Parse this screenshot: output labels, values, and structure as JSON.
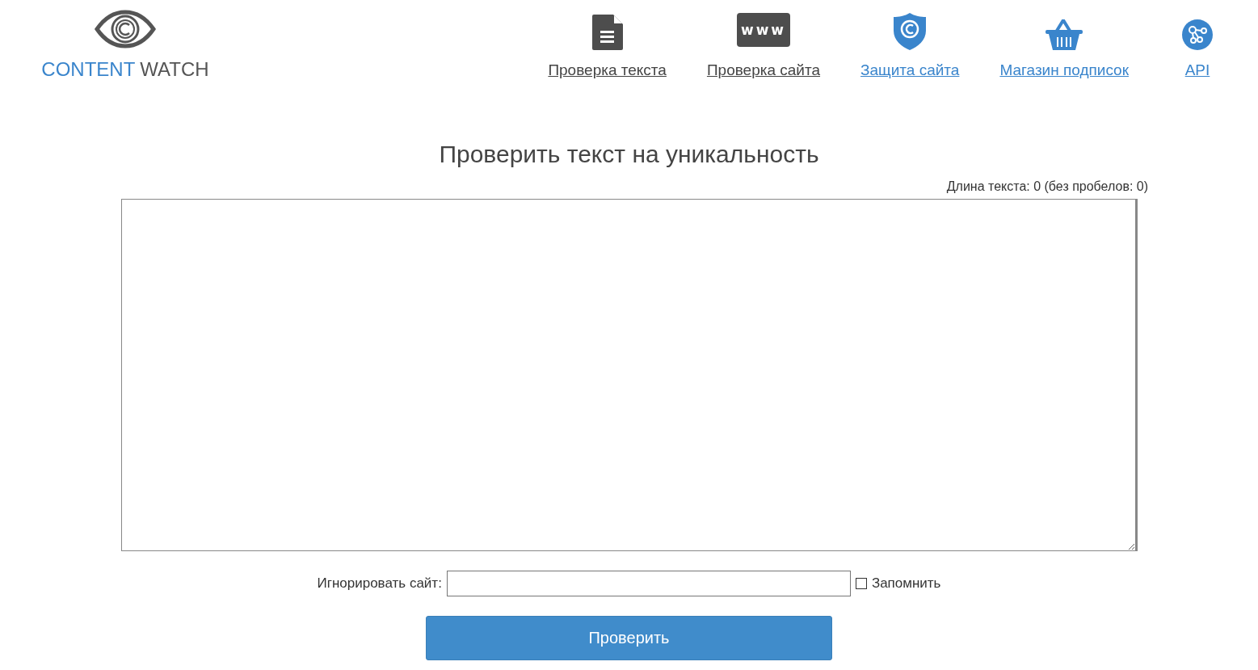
{
  "logo": {
    "brand_first": "CONTENT",
    "brand_second": "WATCH"
  },
  "nav": [
    {
      "kind": "document",
      "label": "Проверка текста",
      "color": "#444444"
    },
    {
      "kind": "www",
      "label": "Проверка сайта",
      "icon_text": "www",
      "color": "#444444"
    },
    {
      "kind": "shield",
      "label": "Защита сайта",
      "color": "#3a85cc"
    },
    {
      "kind": "basket",
      "label": "Магазин подписок",
      "color": "#3a85cc"
    },
    {
      "kind": "api",
      "label": "API",
      "color": "#3a85cc"
    }
  ],
  "heading": "Проверить текст на уникальность",
  "length_info": "Длина текста: 0 (без пробелов: 0)",
  "ignore": {
    "label": "Игнорировать сайт:",
    "remember": {
      "label": "Запомнить",
      "checked": false
    }
  },
  "submit": "Проверить"
}
